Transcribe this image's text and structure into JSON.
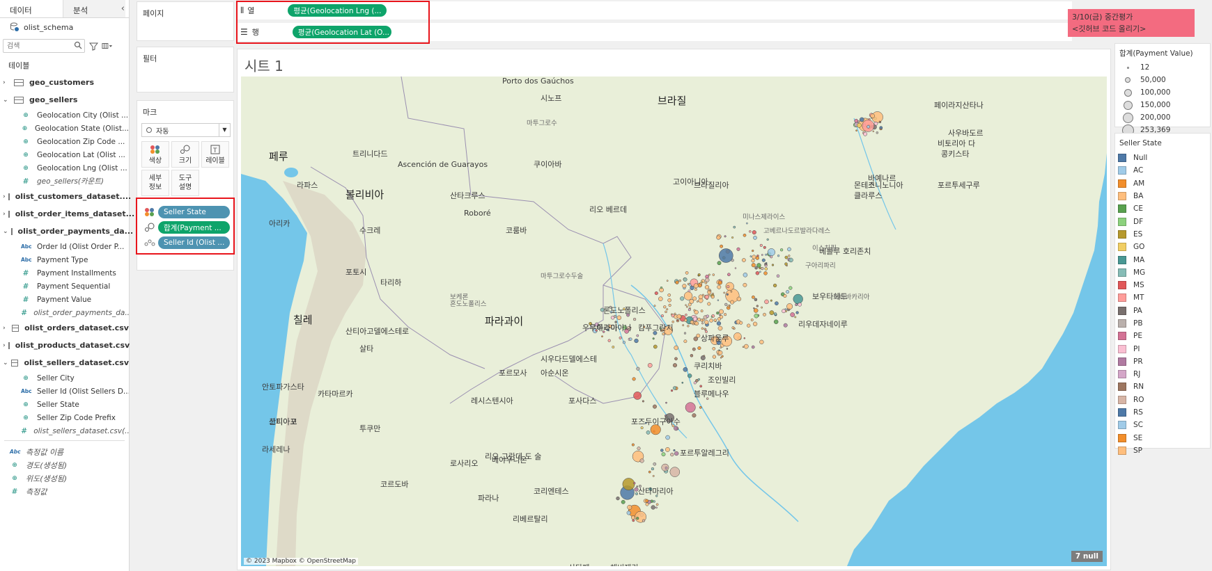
{
  "data_pane": {
    "tabs": [
      {
        "label": "데이터"
      },
      {
        "label": "분석"
      }
    ],
    "collapse_icon": "chevron-left-icon",
    "datasource": "olist_schema",
    "search_placeholder": "검색",
    "tables_label": "테이블",
    "tables": [
      {
        "name": "geo_customers",
        "expanded": false,
        "fields": []
      },
      {
        "name": "geo_sellers",
        "expanded": true,
        "fields": [
          {
            "type": "globe",
            "label": "Geolocation City (Olist ..."
          },
          {
            "type": "globe",
            "label": "Geolocation State (Olist..."
          },
          {
            "type": "globe",
            "label": "Geolocation Zip Code ..."
          },
          {
            "type": "globe",
            "label": "Geolocation Lat (Olist ..."
          },
          {
            "type": "globe",
            "label": "Geolocation Lng (Olist ..."
          },
          {
            "type": "num",
            "label": "geo_sellers(카운트)",
            "italic": true
          }
        ]
      },
      {
        "name": "olist_customers_dataset....",
        "expanded": false,
        "fields": []
      },
      {
        "name": "olist_order_items_dataset...",
        "expanded": false,
        "fields": []
      },
      {
        "name": "olist_order_payments_da...",
        "expanded": true,
        "fields": [
          {
            "type": "abc",
            "label": "Order Id (Olist Order P..."
          },
          {
            "type": "abc",
            "label": "Payment Type"
          },
          {
            "type": "num",
            "label": "Payment Installments"
          },
          {
            "type": "num",
            "label": "Payment Sequential"
          },
          {
            "type": "num",
            "label": "Payment Value"
          },
          {
            "type": "num",
            "label": "olist_order_payments_da...",
            "italic": true
          }
        ]
      },
      {
        "name": "olist_orders_dataset.csv",
        "expanded": false,
        "fields": []
      },
      {
        "name": "olist_products_dataset.csv",
        "expanded": false,
        "fields": []
      },
      {
        "name": "olist_sellers_dataset.csv",
        "expanded": true,
        "fields": [
          {
            "type": "globe",
            "label": "Seller City"
          },
          {
            "type": "abc",
            "label": "Seller Id (Olist Sellers D..."
          },
          {
            "type": "globe",
            "label": "Seller State"
          },
          {
            "type": "globe",
            "label": "Seller Zip Code Prefix"
          },
          {
            "type": "num",
            "label": "olist_sellers_dataset.csv(...",
            "italic": true
          }
        ]
      }
    ],
    "measures": [
      {
        "type": "abc",
        "label": "측정값 이름"
      },
      {
        "type": "globe",
        "label": "경도(생성됨)"
      },
      {
        "type": "globe",
        "label": "위도(생성됨)"
      },
      {
        "type": "num",
        "label": "측정값"
      }
    ]
  },
  "cards": {
    "pages_label": "페이지",
    "filters_label": "필터",
    "marks_label": "마크",
    "marks_type": "자동",
    "mark_buttons": [
      {
        "label": "색상",
        "icon": "color-dots-icon"
      },
      {
        "label": "크기",
        "icon": "size-icon"
      },
      {
        "label": "레이블",
        "icon": "label-icon"
      },
      {
        "label": "세부\n정보",
        "icon": "detail-icon"
      },
      {
        "label": "도구\n설명",
        "icon": "tooltip-icon"
      }
    ],
    "mark_pills": [
      {
        "label": "Seller State",
        "color": "blue",
        "icon": "color-dots-icon"
      },
      {
        "label": "합계(Payment ...",
        "color": "green",
        "icon": "size-icon"
      },
      {
        "label": "Seller Id (Olist ...",
        "color": "blue",
        "icon": "detail-icon"
      }
    ]
  },
  "shelves": {
    "columns_label": "열",
    "columns_pill": "평균(Geolocation Lng (...",
    "rows_label": "행",
    "rows_pill": "평균(Geolocation Lat (O..."
  },
  "note": {
    "line1": "3/10(금) 중간평가",
    "line2": "<깃허브 코드 올리기>"
  },
  "sheet": {
    "title": "시트 1",
    "copyright": "© 2023 Mapbox © OpenStreetMap",
    "null_badge": "7 null"
  },
  "map_labels": {
    "countries": [
      {
        "text": "브라질"
      },
      {
        "text": "볼리비아"
      },
      {
        "text": "파라과이"
      },
      {
        "text": "칠레"
      },
      {
        "text": "페루"
      }
    ],
    "places": [
      "Porto dos Gaúchos",
      "시노프",
      "페이라지산타나",
      "사우바도르",
      "비토리아 다",
      "콩키스타",
      "포르투세구루",
      "코니노니아",
      "브라질리아",
      "몬테스",
      "클라루스",
      "리오 베르데",
      "베를루 호리존치",
      "보우타헤도",
      "리우데자네이루",
      "상파울루",
      "쿠리치바",
      "조인빌리",
      "블루메나우",
      "포르투알레그리",
      "산타마리아",
      "우루과이아나",
      "아리카",
      "라파스",
      "트리니다드",
      "Ascención de Guarayos",
      "Roboré",
      "쿠이아바",
      "코룸바",
      "론도노폴리스",
      "산타크루스",
      "수크레",
      "포토시",
      "타리하",
      "캄푸그란지",
      "우무아라마",
      "포즈두이구아수",
      "안토파가스타",
      "코피아포",
      "라세레나",
      "코르도바",
      "로사리오",
      "산티아고델에스테로",
      "레시스텐시아",
      "포르모사",
      "살타",
      "투쿠만",
      "카타마르카",
      "베야우니온",
      "아순시온",
      "코리엔테스",
      "포사다스",
      "시우다드델에스테",
      "리베르탈리",
      "파라나",
      "산타페",
      "리오 그란데 도 술",
      "체비제리",
      "산티아고",
      "바예나르",
      "고이아니아"
    ],
    "states": [
      "마투그로수",
      "마투그로수두술",
      "미나스제라이스",
      "고베르나도르발라다레스",
      "이스치필",
      "구아리파리",
      "혼도노폴리스",
      "노바바카리아",
      "보케론"
    ]
  },
  "legend_size": {
    "title": "합계(Payment Value)",
    "values": [
      "12",
      "50,000",
      "100,000",
      "150,000",
      "200,000",
      "253,369"
    ]
  },
  "legend_color": {
    "title": "Seller State",
    "items": [
      {
        "label": "Null",
        "color": "#4e79a7"
      },
      {
        "label": "AC",
        "color": "#a0cbe8"
      },
      {
        "label": "AM",
        "color": "#f28e2b"
      },
      {
        "label": "BA",
        "color": "#ffbe7d"
      },
      {
        "label": "CE",
        "color": "#59a14f"
      },
      {
        "label": "DF",
        "color": "#8cd17d"
      },
      {
        "label": "ES",
        "color": "#b6992d"
      },
      {
        "label": "GO",
        "color": "#f1ce63"
      },
      {
        "label": "MA",
        "color": "#499894"
      },
      {
        "label": "MG",
        "color": "#86bcb6"
      },
      {
        "label": "MS",
        "color": "#e15759"
      },
      {
        "label": "MT",
        "color": "#ff9d9a"
      },
      {
        "label": "PA",
        "color": "#79706e"
      },
      {
        "label": "PB",
        "color": "#bab0ac"
      },
      {
        "label": "PE",
        "color": "#d37295"
      },
      {
        "label": "PI",
        "color": "#fabfd2"
      },
      {
        "label": "PR",
        "color": "#b07aa1"
      },
      {
        "label": "RJ",
        "color": "#d4a6c8"
      },
      {
        "label": "RN",
        "color": "#9d7660"
      },
      {
        "label": "RO",
        "color": "#d7b5a6"
      },
      {
        "label": "RS",
        "color": "#4e79a7"
      },
      {
        "label": "SC",
        "color": "#a0cbe8"
      },
      {
        "label": "SE",
        "color": "#f28e2b"
      },
      {
        "label": "SP",
        "color": "#ffbe7d"
      }
    ]
  },
  "colors": {
    "pill_green": "#0ea46a",
    "pill_blue": "#4d93b1",
    "highlight_red": "#e8141b",
    "note_bg": "#f36b80",
    "ocean": "#74c6e9",
    "land": "#e9efd9"
  }
}
